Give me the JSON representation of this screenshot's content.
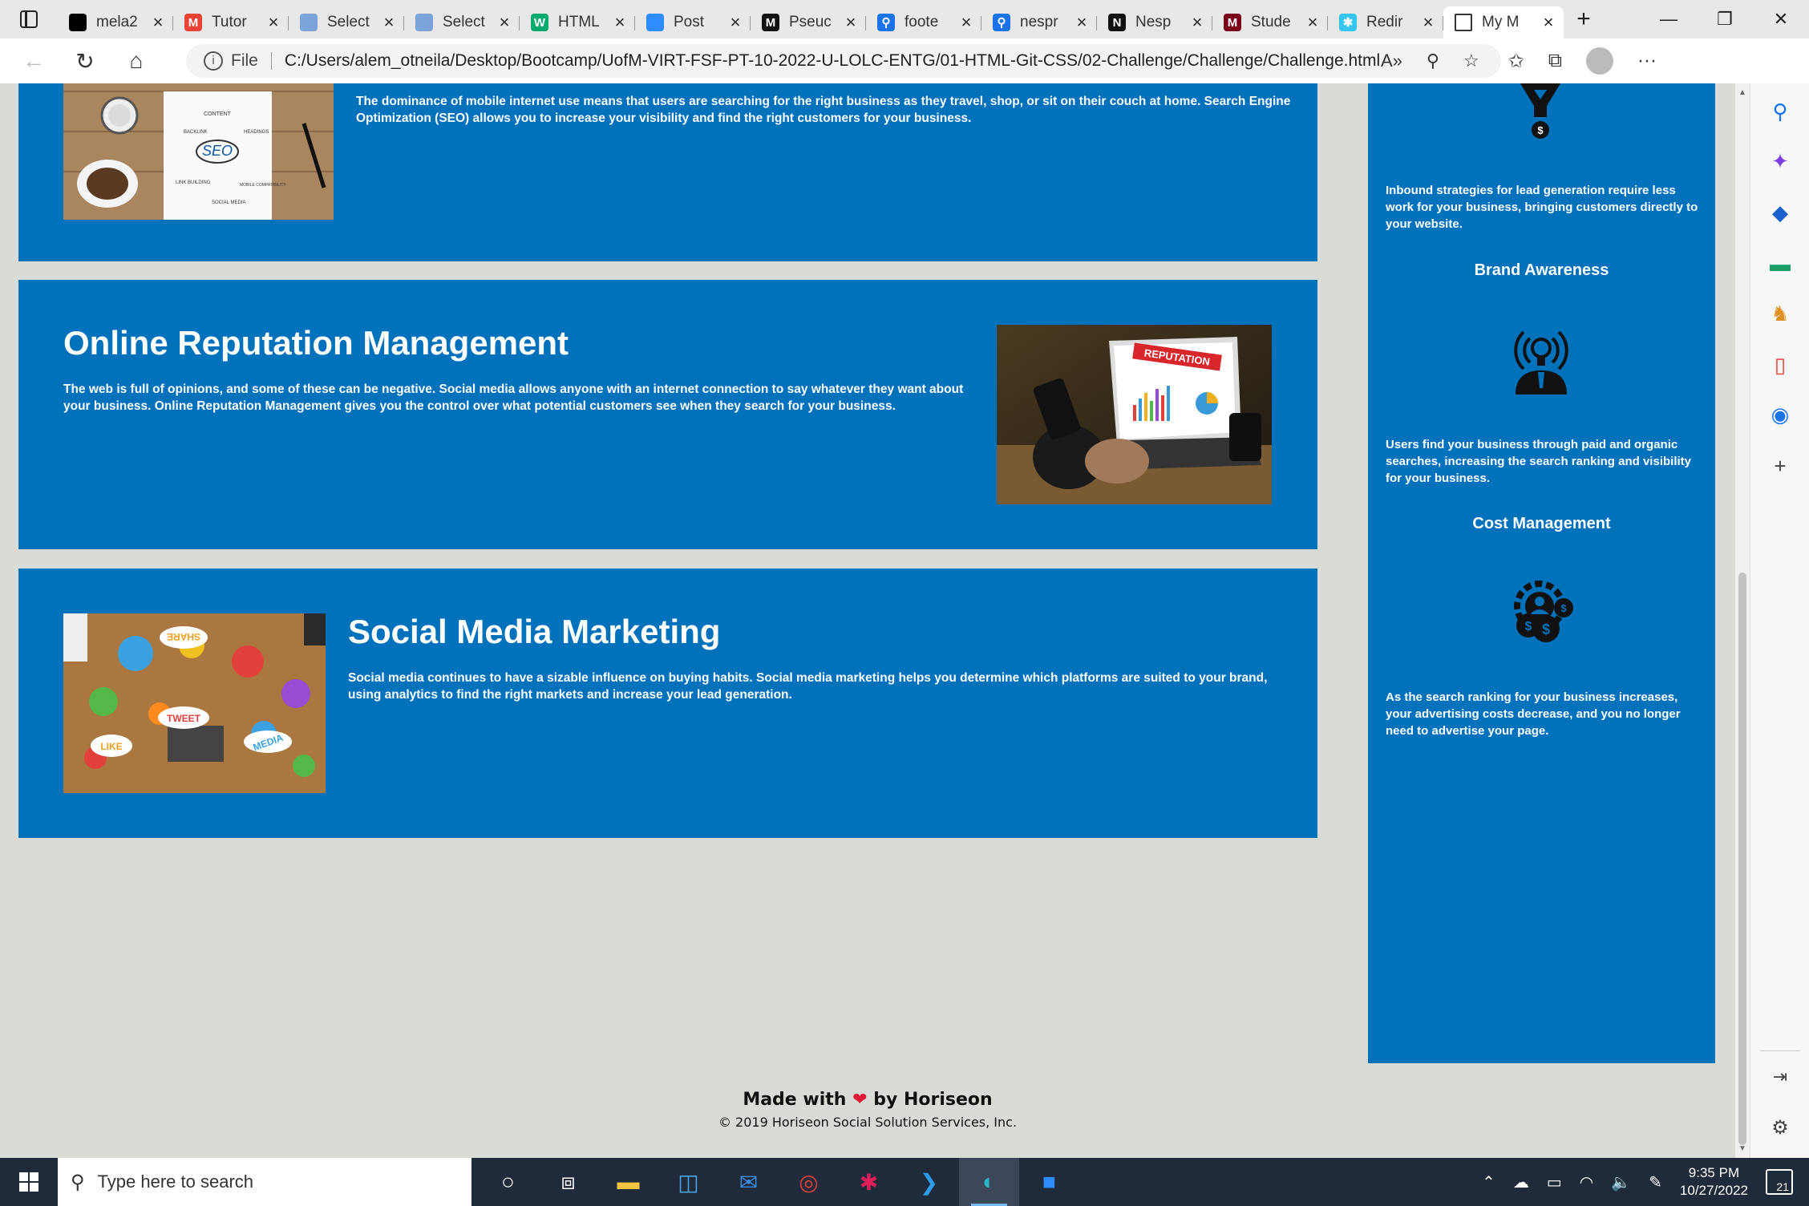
{
  "browser": {
    "tabs": [
      {
        "title": "mela2",
        "icon": "github-icon",
        "color": "#000000",
        "glyph": ""
      },
      {
        "title": "Tutor",
        "icon": "gmail-icon",
        "color": "#ea4335",
        "glyph": "M"
      },
      {
        "title": "Select",
        "icon": "web-page-icon",
        "color": "#7aa3d8",
        "glyph": ""
      },
      {
        "title": "Select",
        "icon": "web-page-icon",
        "color": "#7aa3d8",
        "glyph": ""
      },
      {
        "title": "HTML",
        "icon": "w3schools-icon",
        "color": "#04aa6d",
        "glyph": "W"
      },
      {
        "title": "Post",
        "icon": "zoom-icon",
        "color": "#2d8cff",
        "glyph": ""
      },
      {
        "title": "Pseuc",
        "icon": "medium-icon",
        "color": "#111111",
        "glyph": "M"
      },
      {
        "title": "foote",
        "icon": "search-icon",
        "color": "#1a73e8",
        "glyph": "⚲"
      },
      {
        "title": "nespr",
        "icon": "search-icon",
        "color": "#1a73e8",
        "glyph": "⚲"
      },
      {
        "title": "Nesp",
        "icon": "notion-icon",
        "color": "#111111",
        "glyph": "N"
      },
      {
        "title": "Stude",
        "icon": "umn-icon",
        "color": "#7a0019",
        "glyph": "M"
      },
      {
        "title": "Redir",
        "icon": "slack-icon",
        "color": "#36c5f0",
        "glyph": "✱"
      },
      {
        "title": "My M",
        "icon": "document-icon",
        "color": "#ffffff",
        "glyph": ""
      }
    ],
    "active_tab": 12,
    "address_label": "File",
    "url": "C:/Users/alem_otneila/Desktop/Bootcamp/UofM-VIRT-FSF-PT-10-2022-U-LOLC-ENTG/01-HTML-Git-CSS/02-Challenge/Challenge/Challenge.html"
  },
  "page": {
    "seo": {
      "text": "The dominance of mobile internet use means that users are searching for the right business as they travel, shop, or sit on their couch at home. Search Engine Optimization (SEO) allows you to increase your visibility and find the right customers for your business.",
      "image_words": [
        "SEO",
        "CONTENT",
        "BACKLINK",
        "HEADINGS",
        "LINK BUILDING",
        "MOBILE COMPATIBILITY",
        "SOCIAL MEDIA"
      ]
    },
    "reputation": {
      "title": "Online Reputation Management",
      "text": "The web is full of opinions, and some of these can be negative. Social media allows anyone with an internet connection to say whatever they want about your business. Online Reputation Management gives you the control over what potential customers see when they search for your business.",
      "image_word": "REPUTATION"
    },
    "social": {
      "title": "Social Media Marketing",
      "text": "Social media continues to have a sizable influence on buying habits. Social media marketing helps you determine which platforms are suited to your brand, using analytics to find the right markets and increase your lead generation.",
      "image_words": [
        "SHARE",
        "TWEET",
        "LIKE",
        "MEDIA"
      ]
    },
    "aside": {
      "lead_text": "Inbound strategies for lead generation require less work for your business, bringing customers directly to your website.",
      "brand_title": "Brand Awareness",
      "brand_text": "Users find your business through paid and organic searches, increasing the search ranking and visibility for your business.",
      "cost_title": "Cost Management",
      "cost_text": "As the search ranking for your business increases, your advertising costs decrease, and you no longer need to advertise your page."
    },
    "footer": {
      "made_with": "Made with",
      "by": "by Horiseon",
      "copyright": "© 2019 Horiseon Social Solution Services, Inc."
    }
  },
  "taskbar": {
    "search_placeholder": "Type here to search",
    "time": "9:35 PM",
    "date": "10/27/2022",
    "notifications": "21"
  },
  "colors": {
    "card_blue": "#0072bb",
    "page_bg": "#d9dcd6",
    "heart": "#e0193a"
  }
}
